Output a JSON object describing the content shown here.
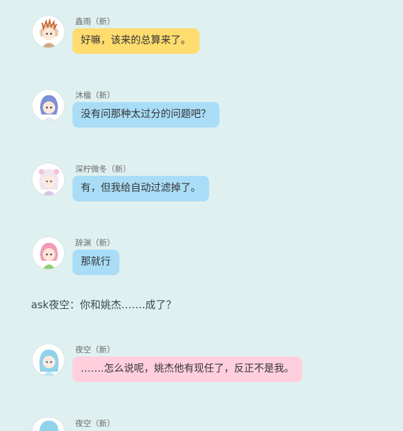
{
  "colors": {
    "background": "#dff0f0",
    "bubble_yellow": "#ffdc6e",
    "bubble_blue": "#a9ddf7",
    "bubble_pink": "#ffcfdd"
  },
  "messages": [
    {
      "speaker": "鑫雨（新）",
      "text": "好嘛，该来的总算来了。",
      "bubble_color": "yellow",
      "avatar_icon": "chibi-avatar-icon"
    },
    {
      "speaker": "沐楹（新）",
      "text": "没有问那种太过分的问题吧？",
      "bubble_color": "blue",
      "avatar_icon": "chibi-avatar-icon"
    },
    {
      "speaker": "深柠微冬（新）",
      "text": "有，但我给自动过滤掉了。",
      "bubble_color": "blue",
      "avatar_icon": "chibi-avatar-icon"
    },
    {
      "speaker": "辞渊（新）",
      "text": "那就行",
      "bubble_color": "blue",
      "avatar_icon": "chibi-avatar-icon"
    },
    {
      "speaker": "夜空（新）",
      "text": "…….怎么说呢，姚杰他有现任了，反正不是我。",
      "bubble_color": "pink",
      "avatar_icon": "chibi-avatar-icon"
    },
    {
      "speaker": "夜空（新）",
      "text": "",
      "bubble_color": "pink",
      "avatar_icon": "chibi-avatar-icon"
    }
  ],
  "narration": "ask夜空：你和姚杰…….成了？"
}
